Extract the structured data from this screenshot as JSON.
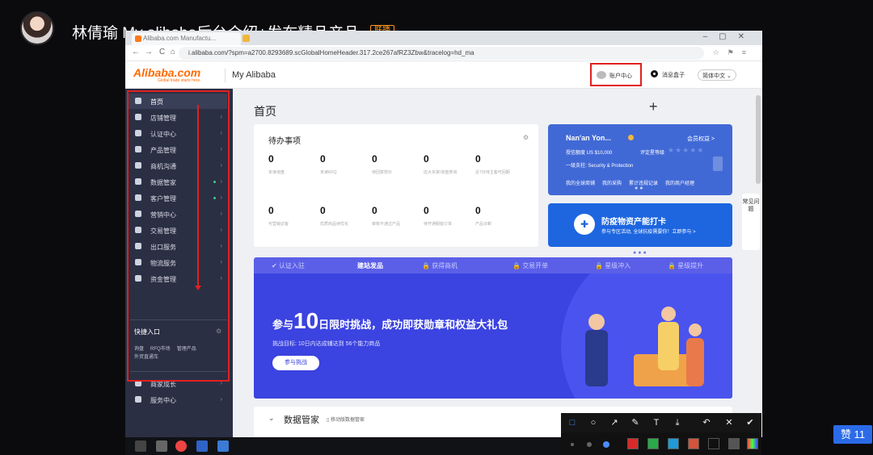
{
  "stream": {
    "title": "林倩瑜 My alibaba后台介绍+发布精品产品",
    "badge": "联播"
  },
  "browser": {
    "tab_title": "Alibaba.com Manufactu...",
    "url": "i.alibaba.com/?spm=a2700.8293689.scGlobalHomeHeader.317.2ce267afRZ3Zbw&tracelog=hd_ma"
  },
  "site": {
    "logo": "Alibaba.com",
    "logo_tagline": "Global trade starts here.",
    "name": "My Alibaba",
    "account_center": "账户中心",
    "messages": "消息盒子",
    "language": "简体中文"
  },
  "sidebar": {
    "items": [
      {
        "label": "首页",
        "icon": "home-icon"
      },
      {
        "label": "店铺管理",
        "icon": "store-icon"
      },
      {
        "label": "认证中心",
        "icon": "shield-icon"
      },
      {
        "label": "产品管理",
        "icon": "grid-icon"
      },
      {
        "label": "商机沟通",
        "icon": "chat-icon"
      },
      {
        "label": "数据管家",
        "icon": "chart-icon"
      },
      {
        "label": "客户管理",
        "icon": "users-icon"
      },
      {
        "label": "营销中心",
        "icon": "target-icon"
      },
      {
        "label": "交易管理",
        "icon": "document-icon"
      },
      {
        "label": "出口服务",
        "icon": "globe-icon"
      },
      {
        "label": "物流服务",
        "icon": "truck-icon"
      },
      {
        "label": "资金管理",
        "icon": "bank-icon"
      }
    ],
    "quick_title": "快捷入口",
    "quick_links": [
      "询盘",
      "RFQ市场",
      "管理产品",
      "外贸直通车"
    ],
    "bottom_items": [
      {
        "label": "商家成长",
        "icon": "heart-icon"
      },
      {
        "label": "服务中心",
        "icon": "service-icon"
      }
    ]
  },
  "main": {
    "page_title": "首页",
    "add_symbol": "+",
    "todo": {
      "title": "待办事项",
      "row1": [
        {
          "value": "0",
          "label": "未读询盘"
        },
        {
          "value": "0",
          "label": "未读RFQ"
        },
        {
          "value": "0",
          "label": "待回复样价"
        },
        {
          "value": "0",
          "label": "店大买家/询盘类询"
        },
        {
          "value": "0",
          "label": "近7日待主客可回期"
        }
      ],
      "row2": [
        {
          "value": "0",
          "label": "可营销访客"
        },
        {
          "value": "0",
          "label": "优质商品待优化"
        },
        {
          "value": "0",
          "label": "审核不通过产品"
        },
        {
          "value": "0",
          "label": "待开通橱窗订单"
        },
        {
          "value": "0",
          "label": "产品诊断"
        }
      ]
    },
    "member": {
      "name": "Nan'an Yon...",
      "rights": "会员权益 >",
      "credit": "授信额度 US $10,000",
      "level": "评定星等级",
      "stars": "★★★★★",
      "sp": "一级支柱: Security & Protection",
      "links": [
        "我的全球商铺",
        "我的采购",
        "累计违规记录",
        "我的商户经理"
      ]
    },
    "promo": {
      "title": "防疫物资产能打卡",
      "subtitle": "参与专区活动, 全球抗疫需要你！立即参与 >"
    },
    "feedback": "常见问题",
    "steps": [
      "认证入驻",
      "建站发品",
      "获得商机",
      "交易开单",
      "星级冲入",
      "星级提升"
    ],
    "banner": {
      "title_pre": "参与",
      "title_days": "10",
      "title_post": "日限时挑战，成功即获勋章和权益大礼包",
      "subtitle": "挑战目标: 10日内达成辅达到 56个能力商品",
      "button": "参与挑战"
    },
    "data_section": {
      "title": "数据管家",
      "link": "移动版数据管家"
    }
  },
  "overlay": {
    "like": "赞 11"
  },
  "colors": {
    "alibaba_orange": "#ff6a00",
    "sidebar_bg": "#2b2f44",
    "annotation_red": "#e02020",
    "banner_blue": "#3b43e0",
    "member_blue": "#4169d6"
  }
}
